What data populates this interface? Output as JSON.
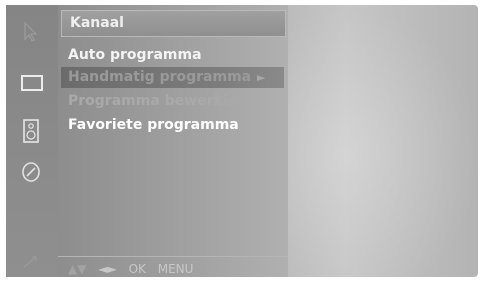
{
  "menu": {
    "title": "Kanaal",
    "items": [
      {
        "label": "Auto programma"
      },
      {
        "label": "Handmatig programma",
        "arrow": "►"
      },
      {
        "label": "Programma bewerking"
      },
      {
        "label": "Favoriete programma"
      }
    ]
  },
  "footer": {
    "nav_updown": "▲▼",
    "nav_leftright": "◄►",
    "ok": "OK",
    "menu": "MENU"
  },
  "sidebar": {
    "icons": [
      "cursor-icon",
      "picture-icon",
      "speaker-icon",
      "options-icon",
      "lock-icon"
    ]
  }
}
